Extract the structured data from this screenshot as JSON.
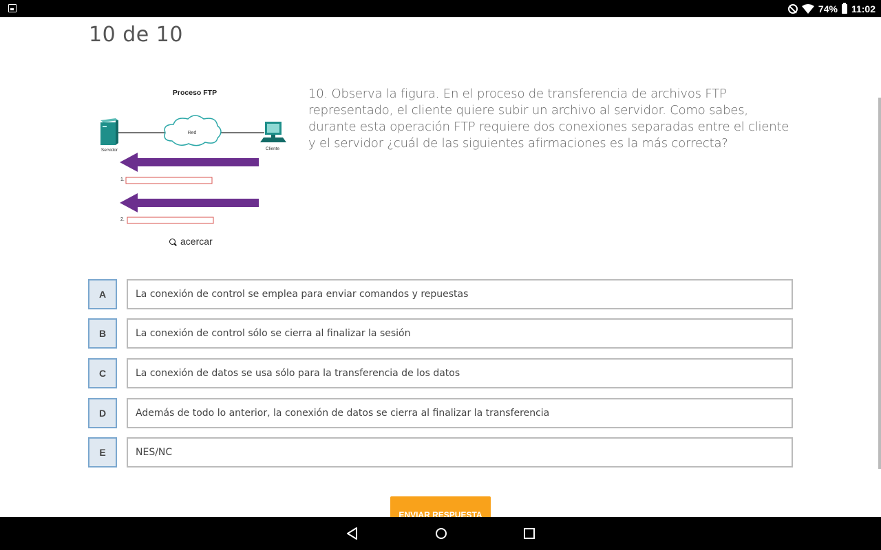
{
  "status_bar": {
    "battery": "74%",
    "time": "11:02"
  },
  "quiz": {
    "counter": "10 de 10",
    "question": "10. Observa la figura. En el proceso de transferencia de archivos FTP representado, el cliente quiere subir un archivo al servidor. Como sabes, durante esta operación FTP requiere dos conexiones separadas entre el cliente y el servidor ¿cuál de las siguientes afirmaciones es la más correcta?",
    "figure": {
      "title": "Proceso FTP",
      "cloud_label": "Red",
      "server_label": "Servidor",
      "client_label": "Cliente",
      "row1_number": "1.",
      "row2_number": "2."
    },
    "zoom_label": "acercar",
    "options": [
      {
        "letter": "A",
        "text": "La conexión de control se emplea para enviar comandos y repuestas"
      },
      {
        "letter": "B",
        "text": "La conexión de control sólo se cierra al finalizar la sesión"
      },
      {
        "letter": "C",
        "text": "La conexión de datos se usa sólo para la transferencia de los datos"
      },
      {
        "letter": "D",
        "text": "Además de todo lo anterior, la conexión de datos se cierra al finalizar la transferencia"
      },
      {
        "letter": "E",
        "text": "NES/NC"
      }
    ],
    "submit_label": "ENVIAR RESPUESTA"
  },
  "colors": {
    "accent": "#f9a21b",
    "arrow": "#6b2f8e",
    "option_border": "#7aa7cf",
    "server": "#1e8f8a"
  },
  "icons": [
    "gallery-icon",
    "do-not-disturb-icon",
    "wifi-icon",
    "battery-icon",
    "search-icon",
    "back-icon",
    "home-icon",
    "recents-icon"
  ]
}
